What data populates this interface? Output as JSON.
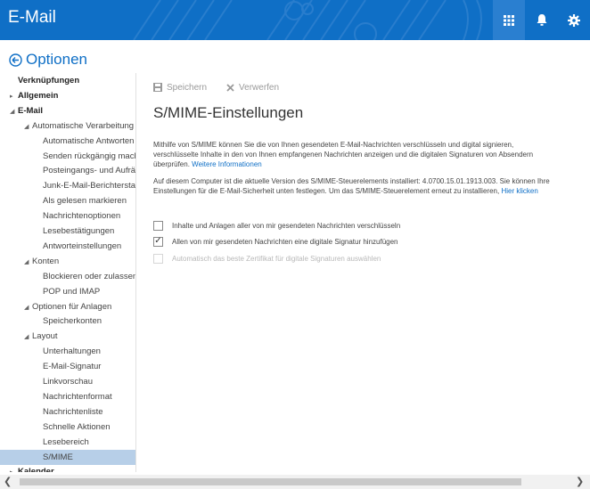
{
  "header": {
    "app_title": "E-Mail",
    "brand_color": "#0f6fc6",
    "icons": [
      "app-launcher-icon",
      "bell-icon",
      "gear-icon"
    ]
  },
  "options_title": "Optionen",
  "sidebar": {
    "items": [
      {
        "label": "Verknüpfungen",
        "level": 0,
        "bold": true,
        "arrow": ""
      },
      {
        "label": "Allgemein",
        "level": 0,
        "bold": true,
        "arrow": "▸"
      },
      {
        "label": "E-Mail",
        "level": 0,
        "bold": true,
        "arrow": "◢"
      },
      {
        "label": "Automatische Verarbeitung",
        "level": 1,
        "arrow": "◢"
      },
      {
        "label": "Automatische Antworten",
        "level": 2
      },
      {
        "label": "Senden rückgängig machen",
        "level": 2
      },
      {
        "label": "Posteingangs- und Aufräumregeln",
        "level": 2
      },
      {
        "label": "Junk-E-Mail-Berichterstattung",
        "level": 2
      },
      {
        "label": "Als gelesen markieren",
        "level": 2
      },
      {
        "label": "Nachrichtenoptionen",
        "level": 2
      },
      {
        "label": "Lesebestätigungen",
        "level": 2
      },
      {
        "label": "Antworteinstellungen",
        "level": 2
      },
      {
        "label": "Konten",
        "level": 1,
        "arrow": "◢"
      },
      {
        "label": "Blockieren oder zulassen",
        "level": 2
      },
      {
        "label": "POP und IMAP",
        "level": 2
      },
      {
        "label": "Optionen für Anlagen",
        "level": 1,
        "arrow": "◢"
      },
      {
        "label": "Speicherkonten",
        "level": 2
      },
      {
        "label": "Layout",
        "level": 1,
        "arrow": "◢"
      },
      {
        "label": "Unterhaltungen",
        "level": 2
      },
      {
        "label": "E-Mail-Signatur",
        "level": 2
      },
      {
        "label": "Linkvorschau",
        "level": 2
      },
      {
        "label": "Nachrichtenformat",
        "level": 2
      },
      {
        "label": "Nachrichtenliste",
        "level": 2
      },
      {
        "label": "Schnelle Aktionen",
        "level": 2
      },
      {
        "label": "Lesebereich",
        "level": 2
      },
      {
        "label": "S/MIME",
        "level": 2,
        "selected": true
      },
      {
        "label": "Kalender",
        "level": 0,
        "bold": true,
        "arrow": "▸"
      }
    ]
  },
  "toolbar": {
    "save_label": "Speichern",
    "discard_label": "Verwerfen"
  },
  "main": {
    "heading": "S/MIME-Einstellungen",
    "intro_text": "Mithilfe von S/MIME können Sie die von Ihnen gesendeten E-Mail-Nachrichten verschlüsseln und digital signieren, verschlüsselte Inhalte in den von Ihnen empfangenen Nachrichten anzeigen und die digitalen Signaturen von Absendern überprüfen.",
    "intro_link": "Weitere Informationen",
    "version_text": "Auf diesem Computer ist die aktuelle Version des S/MIME-Steuerelements installiert: 4.0700.15.01.1913.003. Sie können Ihre Einstellungen für die E-Mail-Sicherheit unten festlegen. Um das S/MIME-Steuerelement erneut zu installieren,",
    "version_link": "Hier klicken",
    "options": [
      {
        "label": "Inhalte und Anlagen aller von mir gesendeten Nachrichten verschlüsseln",
        "checked": false,
        "disabled": false
      },
      {
        "label": "Allen von mir gesendeten Nachrichten eine digitale Signatur hinzufügen",
        "checked": true,
        "disabled": false
      },
      {
        "label": "Automatisch das beste Zertifikat für digitale Signaturen auswählen",
        "checked": false,
        "disabled": true
      }
    ]
  }
}
